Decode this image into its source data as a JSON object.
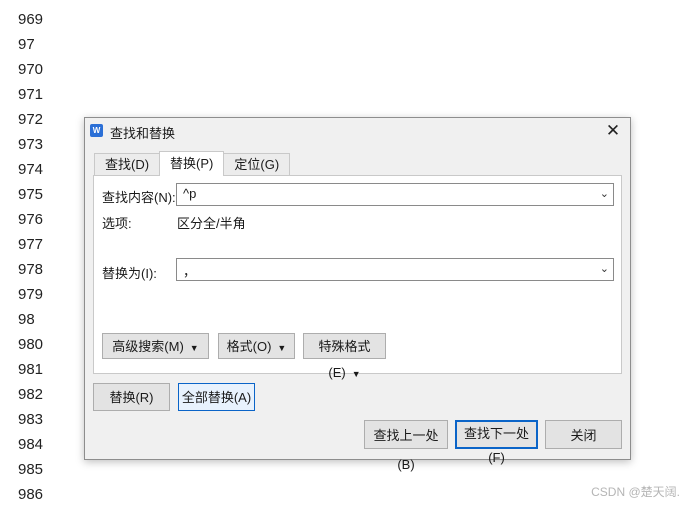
{
  "background_lines": [
    "969",
    "97",
    "970",
    "971",
    "972",
    "973",
    "974",
    "975",
    "976",
    "977",
    "978",
    "979",
    "98",
    "980",
    "981",
    "982",
    "983",
    "984",
    "985",
    "986"
  ],
  "watermark": "CSDN @楚天阔.",
  "dialog": {
    "title": "查找和替换",
    "close_glyph": "✕",
    "app_icon_glyph": "W",
    "tabs": [
      "查找(D)",
      "替换(P)",
      "定位(G)"
    ],
    "active_tab": "替换(P)",
    "find_label": "查找内容(N):",
    "find_value": "^p",
    "options_label": "选项:",
    "options_value": "区分全/半角",
    "replace_label": "替换为(I):",
    "replace_value": "，",
    "advanced_search": "高级搜索(M)",
    "format": "格式(O)",
    "special_format": "特殊格式(E)",
    "replace_btn": "替换(R)",
    "replace_all_btn": "全部替换(A)",
    "find_prev_btn": "查找上一处(B)",
    "find_next_btn": "查找下一处(F)",
    "close_btn": "关闭"
  }
}
